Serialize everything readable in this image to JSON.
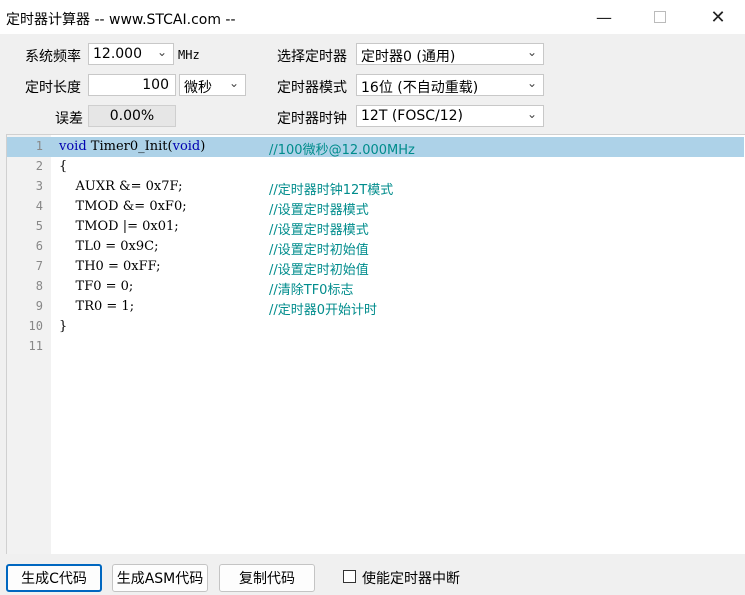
{
  "window": {
    "title": "定时器计算器 -- www.STCAI.com --",
    "min_glyph": "—",
    "close_glyph": "✕"
  },
  "settings": {
    "freq_label": "系统频率",
    "freq_value": "12.000",
    "freq_unit": "MHz",
    "length_label": "定时长度",
    "length_value": "100",
    "length_unit": "微秒",
    "error_label": "误差",
    "error_value": "0.00%",
    "timer_select_label": "选择定时器",
    "timer_select_value": "定时器0 (通用)",
    "timer_mode_label": "定时器模式",
    "timer_mode_value": "16位 (不自动重载)",
    "timer_clock_label": "定时器时钟",
    "timer_clock_value": "12T (FOSC/12)"
  },
  "code_lines": [
    {
      "num": "1",
      "code": " Timer0_Init(",
      "comment": "//100微秒@12.000MHz"
    },
    {
      "num": "2",
      "code": "{",
      "comment": ""
    },
    {
      "num": "3",
      "code": "    AUXR &= 0x7F;",
      "comment": "//定时器时钟12T模式"
    },
    {
      "num": "4",
      "code": "    TMOD &= 0xF0;",
      "comment": "//设置定时器模式"
    },
    {
      "num": "5",
      "code": "    TMOD |= 0x01;",
      "comment": "//设置定时器模式"
    },
    {
      "num": "6",
      "code": "    TL0 = 0x9C;",
      "comment": "//设置定时初始值"
    },
    {
      "num": "7",
      "code": "    TH0 = 0xFF;",
      "comment": "//设置定时初始值"
    },
    {
      "num": "8",
      "code": "    TF0 = 0;",
      "comment": "//清除TF0标志"
    },
    {
      "num": "9",
      "code": "    TR0 = 1;",
      "comment": "//定时器0开始计时"
    },
    {
      "num": "10",
      "code": "}",
      "comment": ""
    },
    {
      "num": "11",
      "code": "",
      "comment": ""
    }
  ],
  "keywords": {
    "void": "void"
  },
  "buttons": {
    "gen_c": "生成C代码",
    "gen_asm": "生成ASM代码",
    "copy": "复制代码",
    "enable_interrupt": "使能定时器中断"
  }
}
